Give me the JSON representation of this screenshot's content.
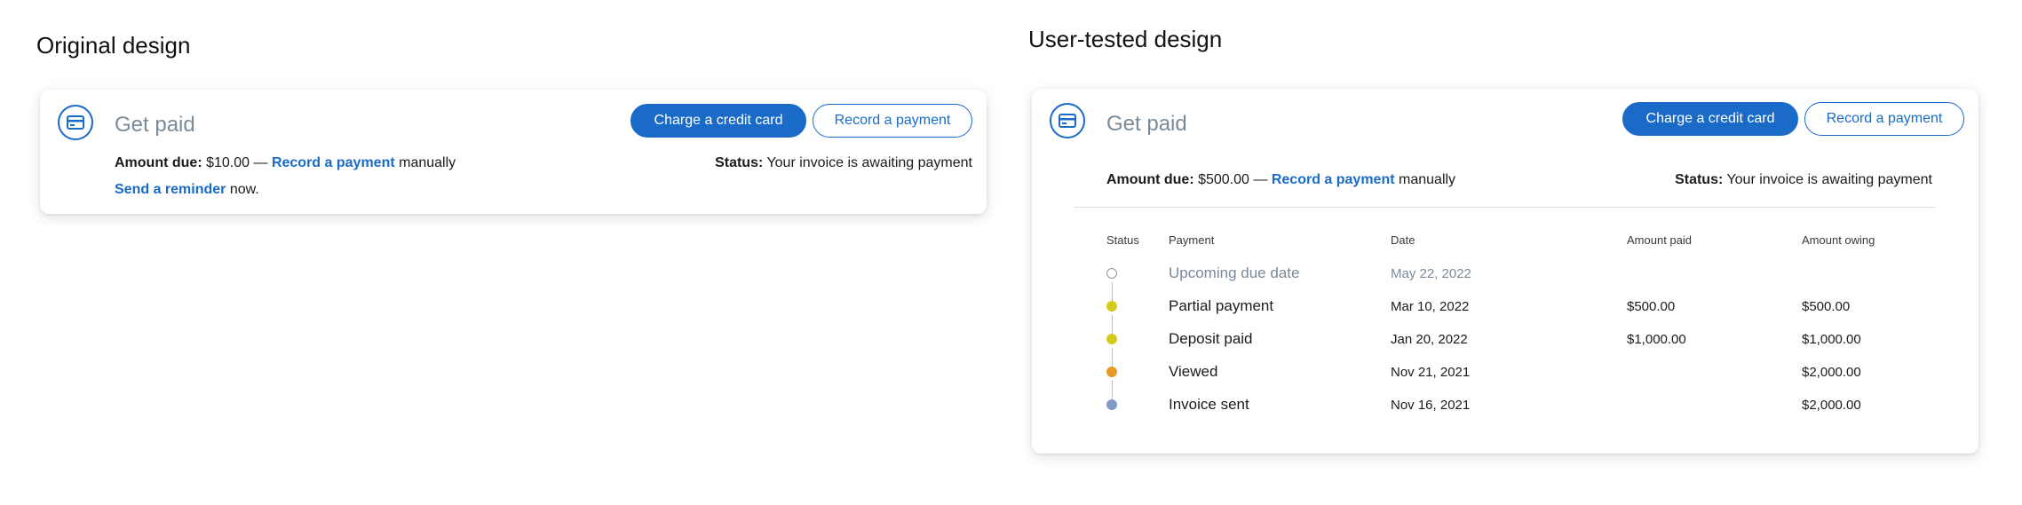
{
  "headings": {
    "original": "Original design",
    "tested": "User-tested design"
  },
  "card1": {
    "title": "Get paid",
    "charge_label": "Charge a credit card",
    "record_label": "Record a payment",
    "amount_due_label": "Amount due:",
    "amount_due_value": "$10.00 —",
    "record_link": "Record a payment",
    "manually": "manually",
    "status_label": "Status:",
    "status_text": "Your invoice is awaiting payment",
    "reminder_link": "Send a reminder",
    "reminder_suffix": "now."
  },
  "card2": {
    "title": "Get paid",
    "charge_label": "Charge a credit card",
    "record_label": "Record a payment",
    "amount_due_label": "Amount due:",
    "amount_due_value": "$500.00 —",
    "record_link": "Record a payment",
    "manually": "manually",
    "status_label": "Status:",
    "status_text": "Your invoice is awaiting payment",
    "table": {
      "headers": [
        "Status",
        "Payment",
        "Date",
        "Amount paid",
        "Amount owing"
      ],
      "rows": [
        {
          "status_color": "#ffffff",
          "payment": "Upcoming due date",
          "date": "May 22, 2022",
          "paid": "",
          "owing": ""
        },
        {
          "status_color": "#d4cc1a",
          "payment": "Partial payment",
          "date": "Mar 10, 2022",
          "paid": "$500.00",
          "owing": "$500.00"
        },
        {
          "status_color": "#d4cc1a",
          "payment": "Deposit paid",
          "date": "Jan 20, 2022",
          "paid": "$1,000.00",
          "owing": "$1,000.00"
        },
        {
          "status_color": "#e79a2a",
          "payment": "Viewed",
          "date": "Nov 21, 2021",
          "paid": "",
          "owing": "$2,000.00"
        },
        {
          "status_color": "#7f9cc9",
          "payment": "Invoice sent",
          "date": "Nov 16, 2021",
          "paid": "",
          "owing": "$2,000.00"
        }
      ]
    }
  },
  "icons": {
    "card_icon": "credit-card-icon"
  },
  "colors": {
    "accent": "#1a6bc7",
    "muted_title": "#7a8a99",
    "yellow": "#d4cc1a",
    "orange": "#e79a2a",
    "blue_grey": "#7f9cc9"
  }
}
